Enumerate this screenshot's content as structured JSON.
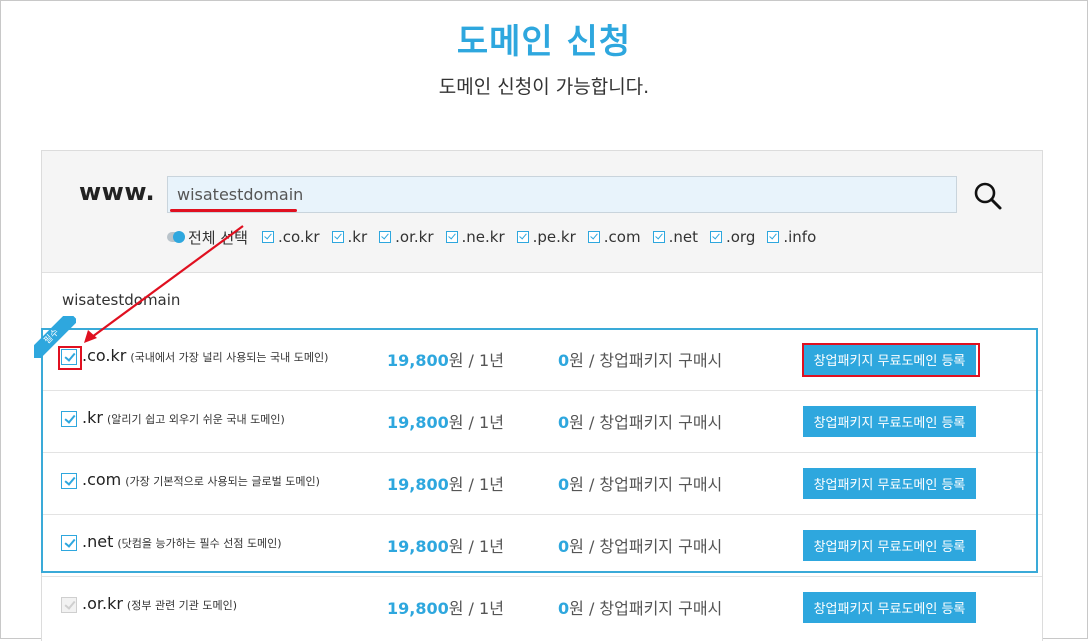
{
  "header": {
    "title": "도메인 신청",
    "subtitle": "도메인 신청이 가능합니다."
  },
  "search": {
    "prefix": "www.",
    "value": "wisatestdomain",
    "button_icon": "search-icon"
  },
  "tld_filter": {
    "select_all_label": "전체 선택",
    "options": [
      ".co.kr",
      ".kr",
      ".or.kr",
      ".ne.kr",
      ".pe.kr",
      ".com",
      ".net",
      ".org",
      ".info"
    ]
  },
  "results": {
    "domain_name": "wisatestdomain",
    "required_badge": "필수",
    "rows": [
      {
        "tld": ".co.kr",
        "desc": "(국내에서 가장 널리 사용되는 국내 도메인)",
        "price": "19,800",
        "price_unit": "원 / 1년",
        "promo_price": "0",
        "promo_text": "원 / 창업패키지 구매시",
        "button": "창업패키지 무료도메인 등록"
      },
      {
        "tld": ".kr",
        "desc": "(알리기 쉽고 외우기 쉬운 국내 도메인)",
        "price": "19,800",
        "price_unit": "원 / 1년",
        "promo_price": "0",
        "promo_text": "원 / 창업패키지 구매시",
        "button": "창업패키지 무료도메인 등록"
      },
      {
        "tld": ".com",
        "desc": "(가장 기본적으로 사용되는 글로벌 도메인)",
        "price": "19,800",
        "price_unit": "원 / 1년",
        "promo_price": "0",
        "promo_text": "원 / 창업패키지 구매시",
        "button": "창업패키지 무료도메인 등록"
      },
      {
        "tld": ".net",
        "desc": "(닷컴을 능가하는 필수 선점 도메인)",
        "price": "19,800",
        "price_unit": "원 / 1년",
        "promo_price": "0",
        "promo_text": "원 / 창업패키지 구매시",
        "button": "창업패키지 무료도메인 등록"
      },
      {
        "tld": ".or.kr",
        "desc": "(정부 관련 기관 도메인)",
        "price": "19,800",
        "price_unit": "원 / 1년",
        "promo_price": "0",
        "promo_text": "원 / 창업패키지 구매시",
        "button": "창업패키지 무료도메인 등록"
      }
    ]
  },
  "colors": {
    "accent": "#2ea7de",
    "highlight": "#e01020"
  }
}
